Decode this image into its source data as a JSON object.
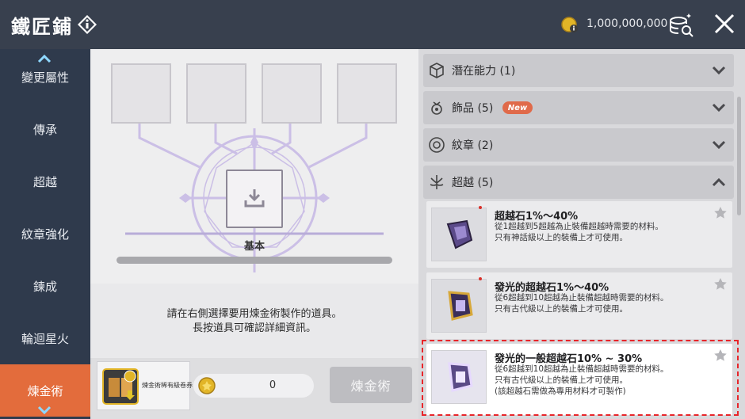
{
  "header": {
    "title": "鐵匠鋪",
    "currency_amount": "1,000,000,000",
    "icons": {
      "info": "info-diamond-icon",
      "coin": "meso-coin-icon",
      "search_coins": "coin-search-icon",
      "close": "close-icon"
    }
  },
  "sidebar": {
    "items": [
      {
        "label": "變更屬性",
        "active": false
      },
      {
        "label": "傳承",
        "active": false
      },
      {
        "label": "超越",
        "active": false
      },
      {
        "label": "紋章強化",
        "active": false
      },
      {
        "label": "鍊成",
        "active": false
      },
      {
        "label": "輪迴星火",
        "active": false
      },
      {
        "label": "煉金術",
        "active": true
      }
    ]
  },
  "center": {
    "grade_label": "基本",
    "instructions_line1": "請在右側選擇要用煉金術製作的道具。",
    "instructions_line2": "長按道具可確認詳細資訊。",
    "voucher_label": "煉金術稀有級卷券",
    "cost_value": "0",
    "alchemy_button": "煉金術"
  },
  "right": {
    "categories": [
      {
        "label": "潛在能力 (1)",
        "icon": "dice-icon",
        "expanded": false
      },
      {
        "label": "飾品 (5)",
        "icon": "accessory-icon",
        "badge": "New",
        "expanded": false
      },
      {
        "label": "紋章 (2)",
        "icon": "emblem-icon",
        "expanded": false
      },
      {
        "label": "超越 (5)",
        "icon": "transcend-icon",
        "expanded": true
      }
    ],
    "items": [
      {
        "name": "超越石1%〜40%",
        "desc1": "從1超越到5超越為止裝備超越時需要的材料。",
        "desc2": " 只有神話級以上的裝備上才可使用。",
        "desc3": ""
      },
      {
        "name": "發光的超越石1%〜40%",
        "desc1": "從6超越到10超越為止裝備超越時需要的材料。",
        "desc2": " 只有古代級以上的裝備上才可使用。",
        "desc3": ""
      },
      {
        "name": "發光的一般超越石10% ~ 30%",
        "desc1": "從6超越到10超越為止裝備超越時需要的材料。",
        "desc2": " 只有古代級以上的裝備上才可使用。",
        "desc3": "(該超越石需做為專用材料才可製作)"
      }
    ]
  },
  "colors": {
    "active_tab": "#e36c3c",
    "new_badge": "#e06a4a",
    "highlight": "#e8252a"
  }
}
